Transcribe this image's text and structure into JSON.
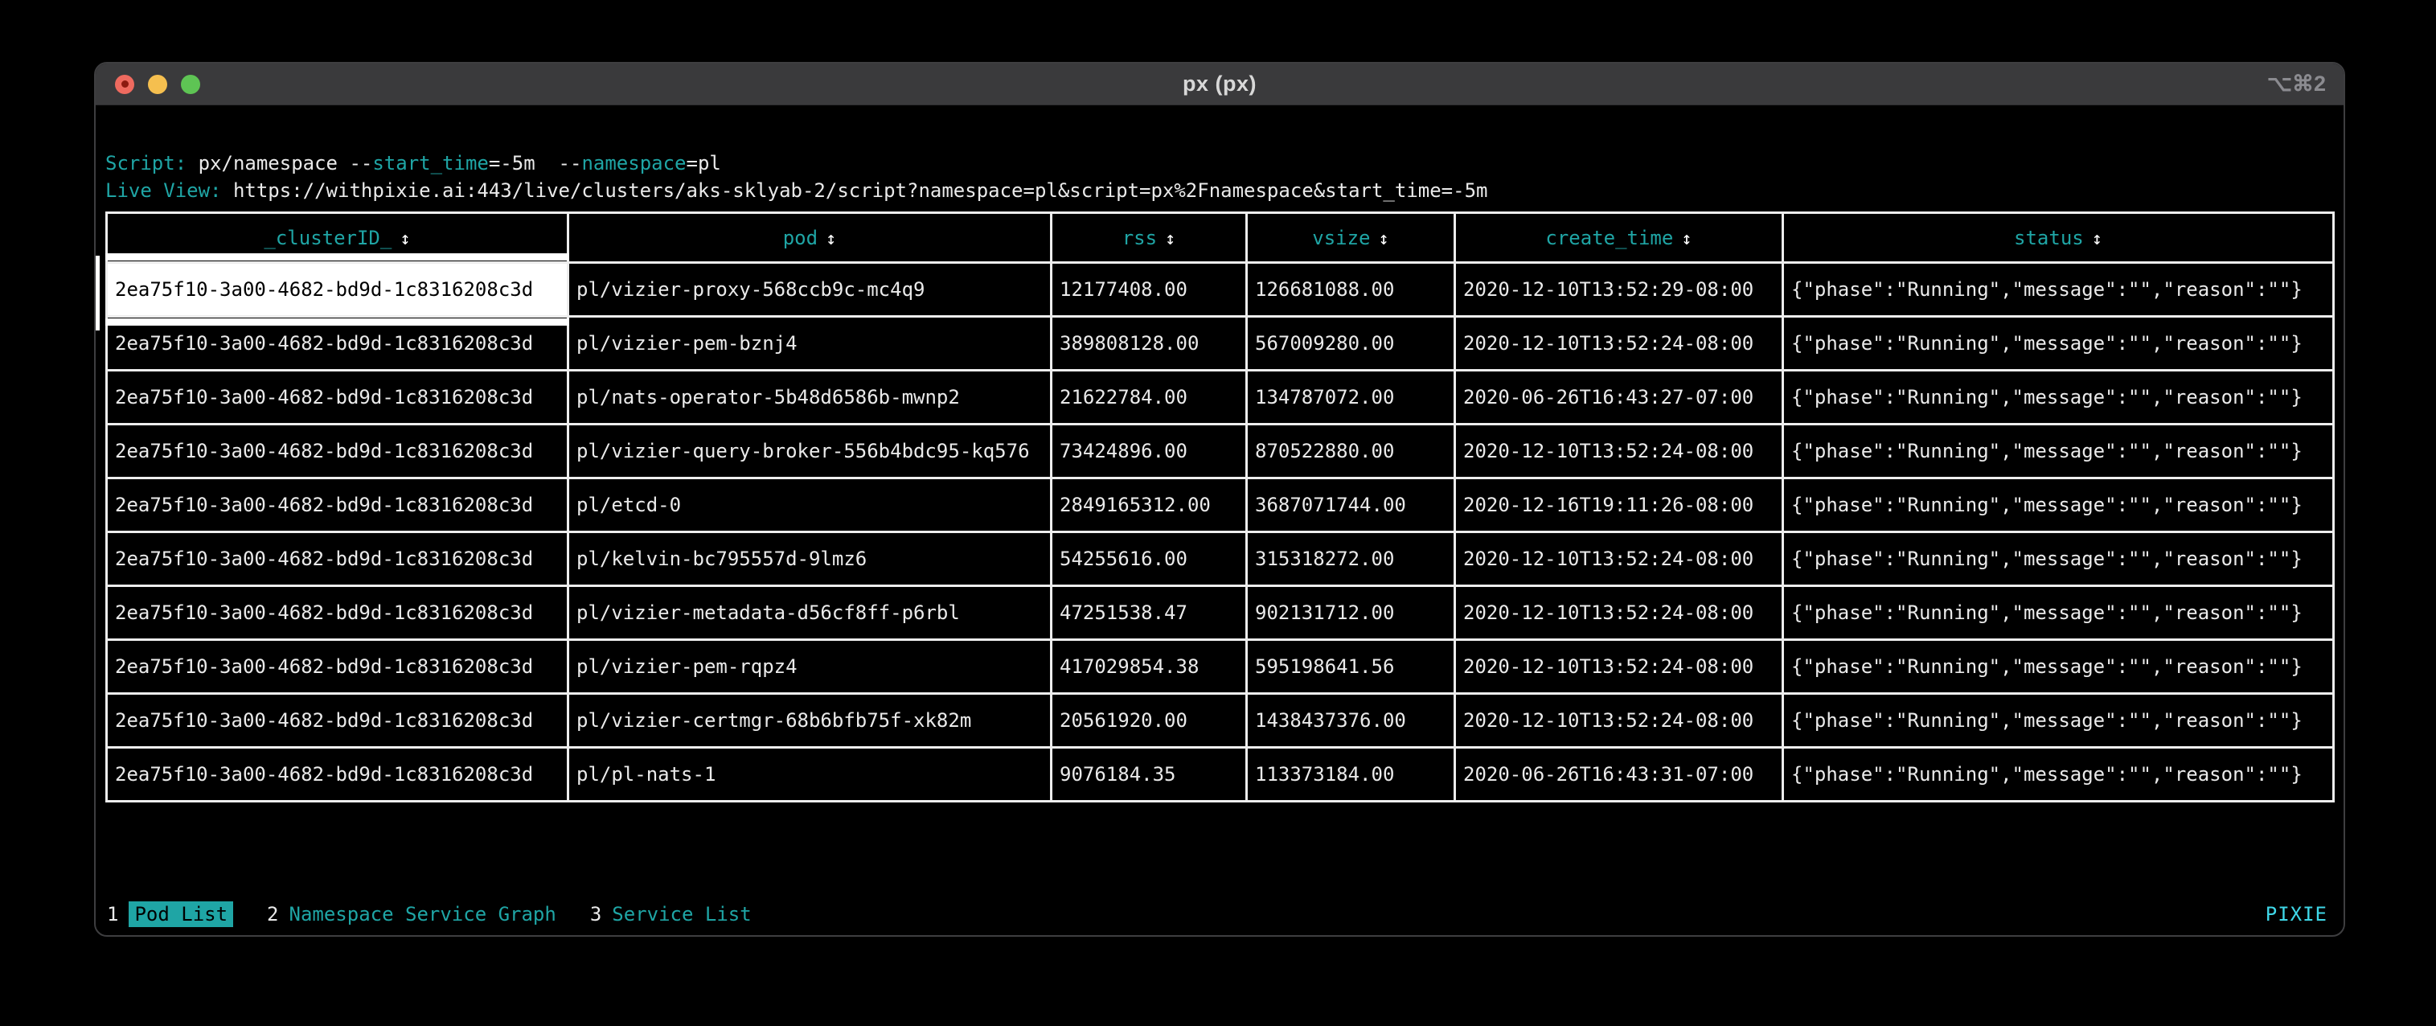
{
  "window": {
    "title": "px (px)",
    "shortcut": "⌥⌘2"
  },
  "script": {
    "label": "Script: ",
    "command": "px/namespace ",
    "flag1_dashes": "--",
    "flag1_name": "start_time",
    "flag1_value": "=-5m",
    "gap": "  ",
    "flag2_dashes": "--",
    "flag2_name": "namespace",
    "flag2_value": "=pl"
  },
  "live_view": {
    "label": "Live View: ",
    "url": "https://withpixie.ai:443/live/clusters/aks-sklyab-2/script?namespace=pl&script=px%2Fnamespace&start_time=-5m"
  },
  "table": {
    "sort_icon": "↕",
    "fields": [
      "clusterID",
      "pod",
      "rss",
      "vsize",
      "create_time",
      "status"
    ],
    "columns": [
      {
        "label": "_clusterID_"
      },
      {
        "label": "pod"
      },
      {
        "label": "rss"
      },
      {
        "label": "vsize"
      },
      {
        "label": "create_time"
      },
      {
        "label": "status"
      }
    ],
    "selected": {
      "row": 0,
      "col": 0
    },
    "rows": [
      {
        "clusterID": "2ea75f10-3a00-4682-bd9d-1c8316208c3d",
        "pod": "pl/vizier-proxy-568ccb9c-mc4q9",
        "rss": "12177408.00",
        "vsize": "126681088.00",
        "create_time": "2020-12-10T13:52:29-08:00",
        "status": "{\"phase\":\"Running\",\"message\":\"\",\"reason\":\"\"}"
      },
      {
        "clusterID": "2ea75f10-3a00-4682-bd9d-1c8316208c3d",
        "pod": "pl/vizier-pem-bznj4",
        "rss": "389808128.00",
        "vsize": "567009280.00",
        "create_time": "2020-12-10T13:52:24-08:00",
        "status": "{\"phase\":\"Running\",\"message\":\"\",\"reason\":\"\"}"
      },
      {
        "clusterID": "2ea75f10-3a00-4682-bd9d-1c8316208c3d",
        "pod": "pl/nats-operator-5b48d6586b-mwnp2",
        "rss": "21622784.00",
        "vsize": "134787072.00",
        "create_time": "2020-06-26T16:43:27-07:00",
        "status": "{\"phase\":\"Running\",\"message\":\"\",\"reason\":\"\"}"
      },
      {
        "clusterID": "2ea75f10-3a00-4682-bd9d-1c8316208c3d",
        "pod": "pl/vizier-query-broker-556b4bdc95-kq576",
        "rss": "73424896.00",
        "vsize": "870522880.00",
        "create_time": "2020-12-10T13:52:24-08:00",
        "status": "{\"phase\":\"Running\",\"message\":\"\",\"reason\":\"\"}"
      },
      {
        "clusterID": "2ea75f10-3a00-4682-bd9d-1c8316208c3d",
        "pod": "pl/etcd-0",
        "rss": "2849165312.00",
        "vsize": "3687071744.00",
        "create_time": "2020-12-16T19:11:26-08:00",
        "status": "{\"phase\":\"Running\",\"message\":\"\",\"reason\":\"\"}"
      },
      {
        "clusterID": "2ea75f10-3a00-4682-bd9d-1c8316208c3d",
        "pod": "pl/kelvin-bc795557d-9lmz6",
        "rss": "54255616.00",
        "vsize": "315318272.00",
        "create_time": "2020-12-10T13:52:24-08:00",
        "status": "{\"phase\":\"Running\",\"message\":\"\",\"reason\":\"\"}"
      },
      {
        "clusterID": "2ea75f10-3a00-4682-bd9d-1c8316208c3d",
        "pod": "pl/vizier-metadata-d56cf8ff-p6rbl",
        "rss": "47251538.47",
        "vsize": "902131712.00",
        "create_time": "2020-12-10T13:52:24-08:00",
        "status": "{\"phase\":\"Running\",\"message\":\"\",\"reason\":\"\"}"
      },
      {
        "clusterID": "2ea75f10-3a00-4682-bd9d-1c8316208c3d",
        "pod": "pl/vizier-pem-rqpz4",
        "rss": "417029854.38",
        "vsize": "595198641.56",
        "create_time": "2020-12-10T13:52:24-08:00",
        "status": "{\"phase\":\"Running\",\"message\":\"\",\"reason\":\"\"}"
      },
      {
        "clusterID": "2ea75f10-3a00-4682-bd9d-1c8316208c3d",
        "pod": "pl/vizier-certmgr-68b6bfb75f-xk82m",
        "rss": "20561920.00",
        "vsize": "1438437376.00",
        "create_time": "2020-12-10T13:52:24-08:00",
        "status": "{\"phase\":\"Running\",\"message\":\"\",\"reason\":\"\"}"
      },
      {
        "clusterID": "2ea75f10-3a00-4682-bd9d-1c8316208c3d",
        "pod": "pl/pl-nats-1",
        "rss": "9076184.35",
        "vsize": "113373184.00",
        "create_time": "2020-06-26T16:43:31-07:00",
        "status": "{\"phase\":\"Running\",\"message\":\"\",\"reason\":\"\"}"
      }
    ]
  },
  "tabs": {
    "items": [
      {
        "key": "1",
        "label": "Pod List",
        "active": true
      },
      {
        "key": "2",
        "label": "Namespace Service Graph",
        "active": false
      },
      {
        "key": "3",
        "label": "Service List",
        "active": false
      }
    ],
    "brand": "PIXIE"
  },
  "colors": {
    "teal": "#1fa5a5",
    "bright_cyan": "#3fd7e8",
    "table_border": "#ededed",
    "titlebar": "#3a3a3c",
    "background": "#000000",
    "selected_cell_bg": "#ffffff",
    "traffic_red": "#ee6a5f",
    "traffic_yellow": "#f5bf4f",
    "traffic_green": "#5ec454"
  }
}
